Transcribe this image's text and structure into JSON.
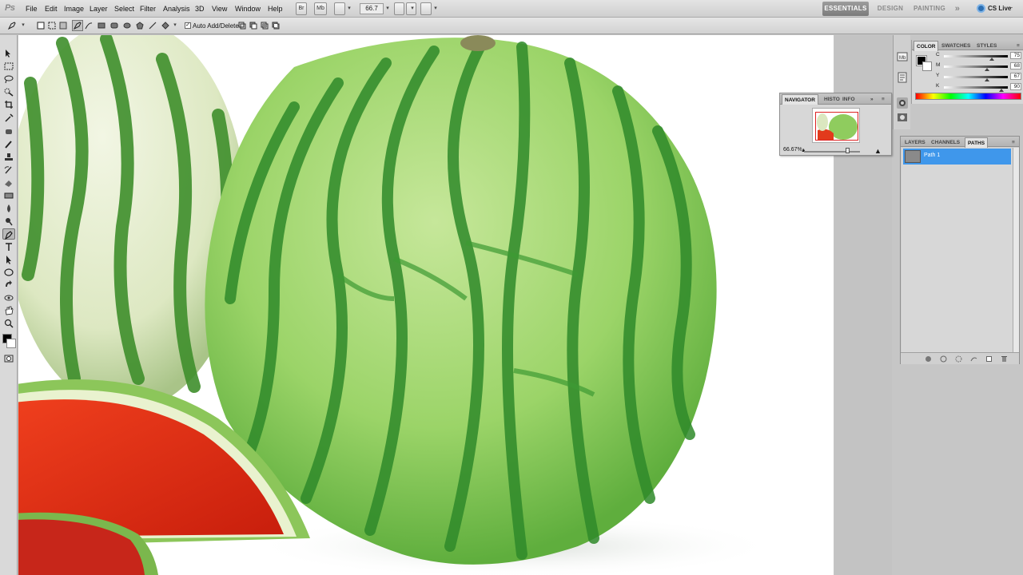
{
  "app": {
    "logo": "Ps"
  },
  "menu": [
    "File",
    "Edit",
    "Image",
    "Layer",
    "Select",
    "Filter",
    "Analysis",
    "3D",
    "View",
    "Window",
    "Help"
  ],
  "appbar": {
    "br_label": "Br",
    "mb_label": "Mb",
    "zoom": "66.7"
  },
  "workspaces": [
    "ESSENTIALS",
    "DESIGN",
    "PAINTING"
  ],
  "workspace_more": "»",
  "cslive": "CS Live",
  "options": {
    "auto_add_delete": "Auto Add/Delete",
    "auto_add_checked": true
  },
  "navigator": {
    "tabs": [
      "NAVIGATOR",
      "HISTO",
      "INFO"
    ],
    "zoom": "66.67%"
  },
  "color_panel": {
    "tabs": [
      "COLOR",
      "SWATCHES",
      "STYLES"
    ],
    "channels": [
      {
        "label": "C",
        "value": "75",
        "pct": "%",
        "level": 0.75
      },
      {
        "label": "M",
        "value": "68",
        "pct": "%",
        "level": 0.68
      },
      {
        "label": "Y",
        "value": "67",
        "pct": "%",
        "level": 0.67
      },
      {
        "label": "K",
        "value": "90",
        "pct": "%",
        "level": 0.9
      }
    ]
  },
  "layers_panel": {
    "tabs": [
      "LAYERS",
      "CHANNELS",
      "PATHS"
    ],
    "paths": [
      {
        "name": "Path 1"
      }
    ]
  },
  "colors": {
    "selection": "#3f97eb",
    "foreground": "#000000",
    "background": "#ffffff"
  }
}
